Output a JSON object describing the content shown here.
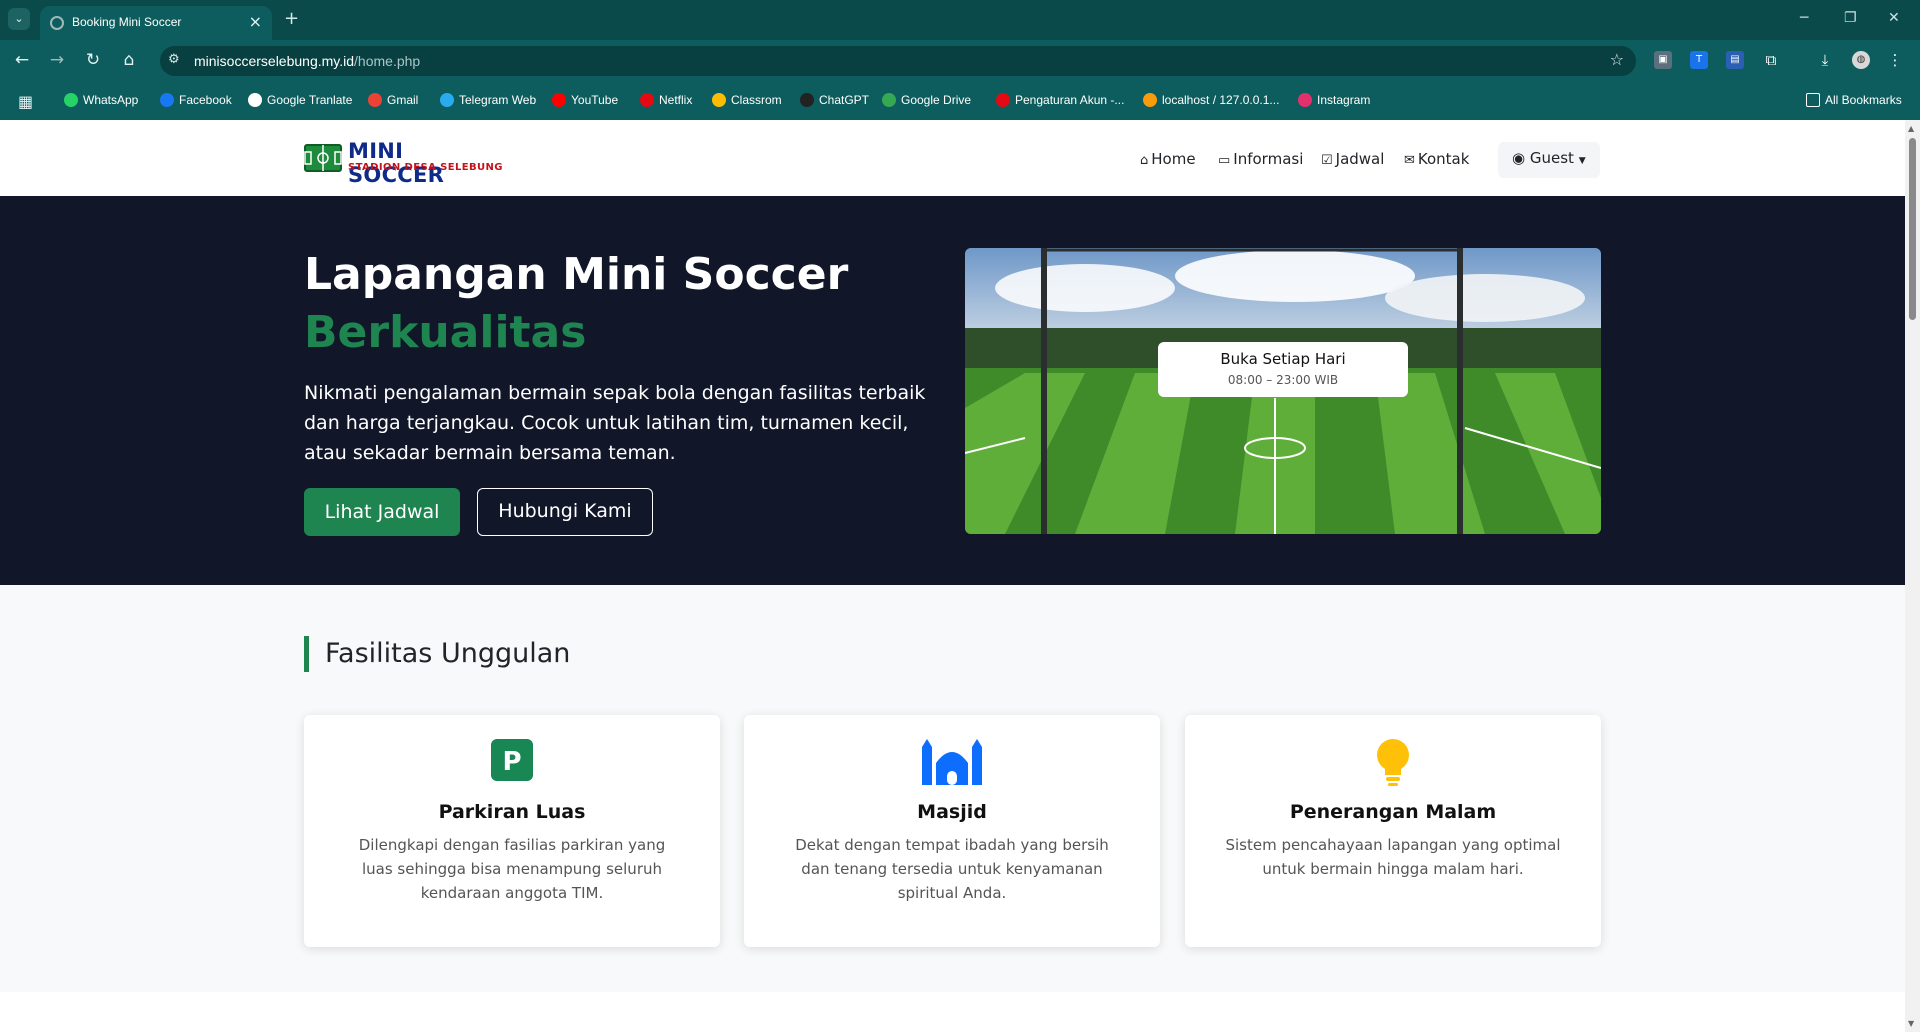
{
  "browser": {
    "tab_title": "Booking Mini Soccer",
    "url_host": "minisoccerselebung.my.id",
    "url_path": "/home.php",
    "bookmarks": [
      {
        "label": "WhatsApp",
        "color": "#25d366"
      },
      {
        "label": "Facebook",
        "color": "#1877f2"
      },
      {
        "label": "Google Tranlate",
        "color": "#ffffff"
      },
      {
        "label": "Gmail",
        "color": "#ea4335"
      },
      {
        "label": "Telegram Web",
        "color": "#2aabee"
      },
      {
        "label": "YouTube",
        "color": "#ff0000"
      },
      {
        "label": "Netflix",
        "color": "#e50914"
      },
      {
        "label": "Classrom",
        "color": "#fbbc04"
      },
      {
        "label": "ChatGPT",
        "color": "#222222"
      },
      {
        "label": "Google Drive",
        "color": "#34a853"
      },
      {
        "label": "Pengaturan Akun -...",
        "color": "#e50914"
      },
      {
        "label": "localhost / 127.0.0.1...",
        "color": "#f89c0e"
      },
      {
        "label": "Instagram",
        "color": "#e1306c"
      }
    ],
    "all_bookmarks": "All Bookmarks"
  },
  "site": {
    "logo_title": "MINI SOCCER",
    "logo_subtitle": "STADION DESA SELEBUNG",
    "nav": {
      "home": "Home",
      "informasi": "Informasi",
      "jadwal": "Jadwal",
      "kontak": "Kontak",
      "guest": "Guest"
    }
  },
  "hero": {
    "title_line1": "Lapangan Mini Soccer",
    "title_line2": "Berkualitas",
    "description": "Nikmati pengalaman bermain sepak bola dengan fasilitas terbaik dan harga terjangkau. Cocok untuk latihan tim, turnamen kecil, atau sekadar bermain bersama teman.",
    "btn_primary": "Lihat Jadwal",
    "btn_secondary": "Hubungi Kami",
    "hours_title": "Buka Setiap Hari",
    "hours_time": "08:00 – 23:00 WIB"
  },
  "facilities": {
    "heading": "Fasilitas Unggulan",
    "items": [
      {
        "title": "Parkiran Luas",
        "text": "Dilengkapi dengan fasilias parkiran yang luas sehingga bisa menampung seluruh kendaraan anggota TIM.",
        "icon": "parking-icon",
        "color": "#198754"
      },
      {
        "title": "Masjid",
        "text": "Dekat dengan tempat ibadah yang bersih dan tenang tersedia untuk kenyamanan spiritual Anda.",
        "icon": "mosque-icon",
        "color": "#0d6efd"
      },
      {
        "title": "Penerangan Malam",
        "text": "Sistem pencahayaan lapangan yang optimal untuk bermain hingga malam hari.",
        "icon": "lightbulb-icon",
        "color": "#ffc107"
      }
    ]
  }
}
